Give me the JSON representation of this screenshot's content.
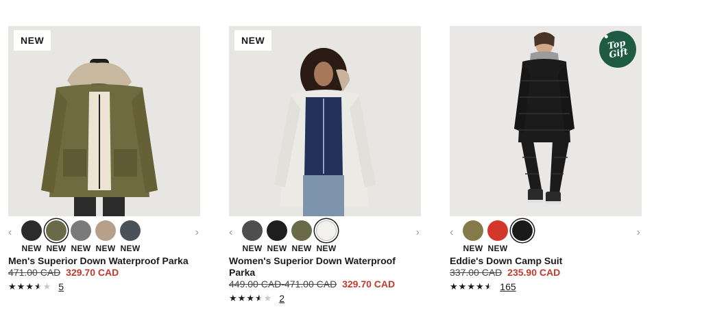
{
  "products": [
    {
      "badge": "NEW",
      "swatches": [
        {
          "color": "#2b2b2b",
          "label": "NEW"
        },
        {
          "color": "#6b6a48",
          "label": "NEW"
        },
        {
          "color": "#7a7a7a",
          "label": "NEW"
        },
        {
          "color": "#b6a08a",
          "label": "NEW"
        },
        {
          "color": "#4a5158",
          "label": "NEW"
        }
      ],
      "title": "Men's Superior Down Waterproof Parka",
      "price_original": "471.00 CAD",
      "price_sale": "329.70 CAD",
      "rating": 3.5,
      "review_count": "5"
    },
    {
      "badge": "NEW",
      "swatches": [
        {
          "color": "#4e4e4e",
          "label": "NEW"
        },
        {
          "color": "#1e1e1e",
          "label": "NEW"
        },
        {
          "color": "#6b6a48",
          "label": "NEW"
        },
        {
          "color": "#f3f1ec",
          "label": "NEW"
        }
      ],
      "title": "Women's Superior Down Waterproof Parka",
      "price_original": "449.00 CAD-471.00 CAD",
      "price_sale": "329.70 CAD",
      "rating": 3.5,
      "review_count": "2"
    },
    {
      "badge_top": "Top",
      "badge_gift": "Gift",
      "swatches": [
        {
          "color": "#857a4a",
          "label": "NEW"
        },
        {
          "color": "#d3372b",
          "label": "NEW"
        },
        {
          "color": "#1a1a1a",
          "label": ""
        }
      ],
      "title": "Eddie's Down Camp Suit",
      "price_original": "337.00 CAD",
      "price_sale": "235.90 CAD",
      "rating": 4.5,
      "review_count": "165"
    }
  ],
  "icons": {
    "prev": "chevron-left-icon",
    "next": "chevron-right-icon",
    "star": "star-icon"
  }
}
